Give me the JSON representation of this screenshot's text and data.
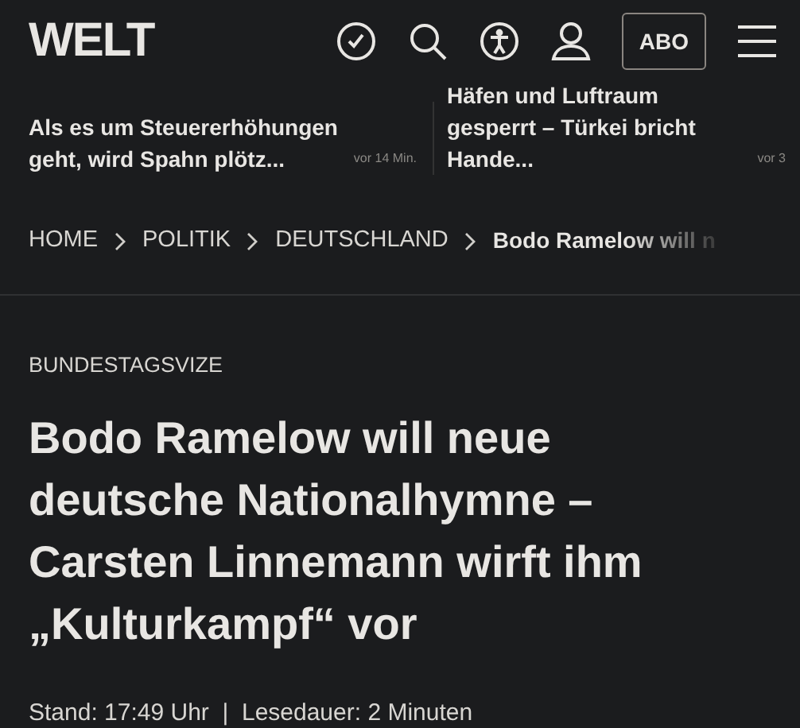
{
  "header": {
    "logo": "WELT",
    "subscribe_button": "ABO"
  },
  "teasers": [
    {
      "title": "Als es um Steuererhöhungen geht, wird Spahn plötz...",
      "time": "vor 14 Min."
    },
    {
      "title": "Häfen und Luftraum gesperrt – Türkei bricht Hande...",
      "time": "vor 3"
    }
  ],
  "breadcrumb": [
    {
      "label": "HOME",
      "current": false
    },
    {
      "label": "POLITIK",
      "current": false
    },
    {
      "label": "DEUTSCHLAND",
      "current": false
    },
    {
      "label": "Bodo Ramelow will n",
      "current": true
    }
  ],
  "article": {
    "kicker": "BUNDESTAGSVIZE",
    "headline": "Bodo Ramelow will neue deutsche Nationalhymne – Carsten Linnemann wirft ihm „Kulturkampf“ vor",
    "meta": "Stand: 17:49 Uhr  |  Lesedauer: 2 Minuten"
  }
}
